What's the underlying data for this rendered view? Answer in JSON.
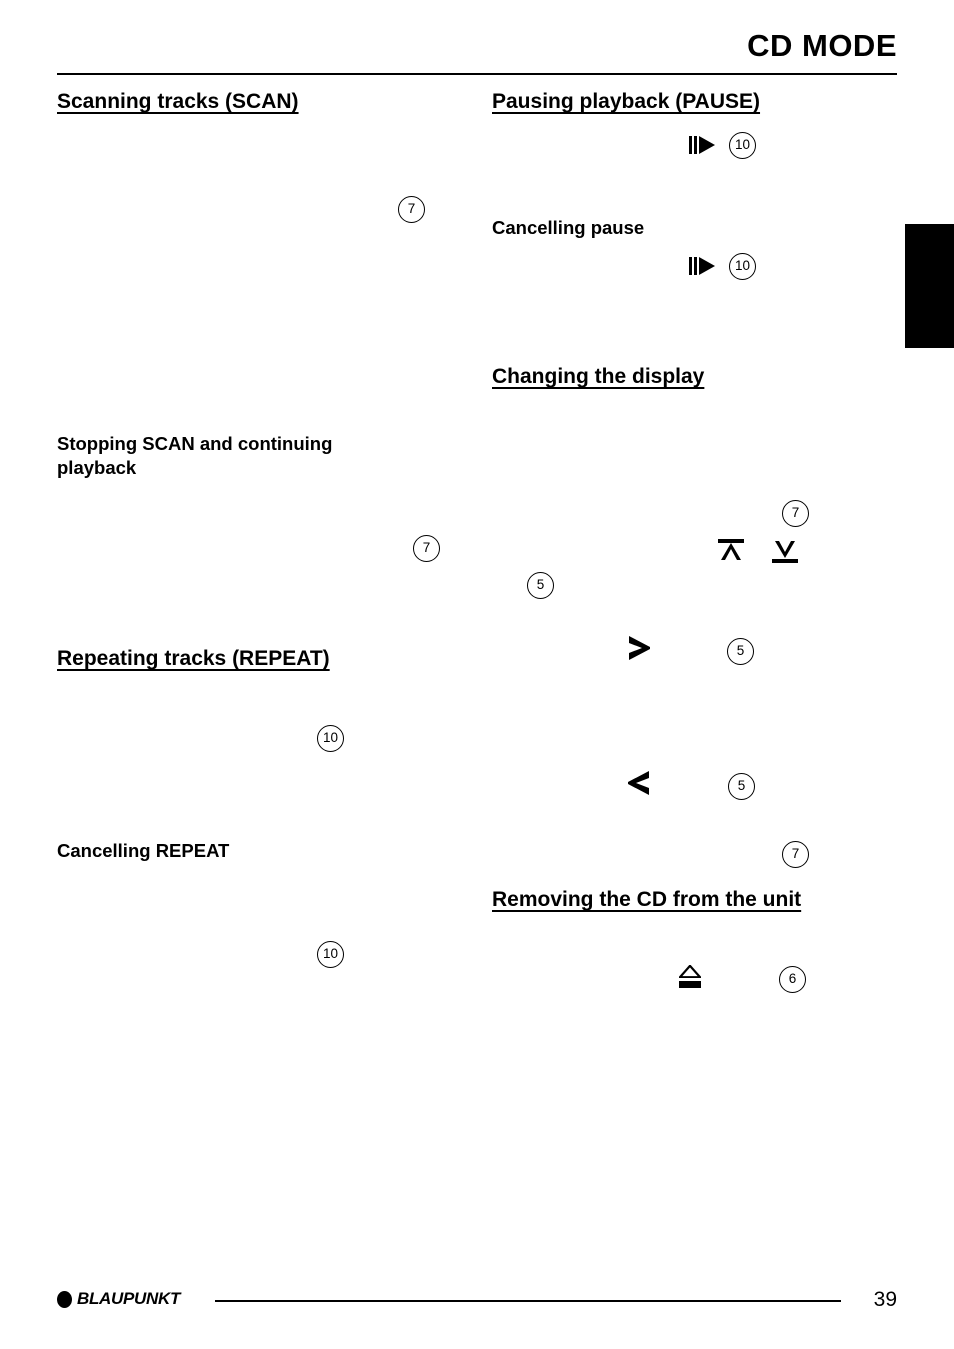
{
  "document": {
    "header_title": "CD MODE",
    "page_number": "39",
    "brand": "BLAUPUNKT"
  },
  "left_column": {
    "sections": [
      {
        "heading": "Scanning tracks (SCAN)",
        "refs": [
          {
            "label": "7"
          }
        ]
      },
      {
        "subheading_line1": "Stopping SCAN and continuing",
        "subheading_line2": "playback",
        "refs": [
          {
            "label": "7"
          }
        ]
      },
      {
        "heading": "Repeating tracks (REPEAT)",
        "refs": [
          {
            "label": "10"
          }
        ]
      },
      {
        "subheading": "Cancelling REPEAT",
        "refs": [
          {
            "label": "10"
          }
        ]
      }
    ]
  },
  "right_column": {
    "sections": [
      {
        "heading": "Pausing playback (PAUSE)",
        "icon": "pause-play-icon",
        "refs": [
          {
            "label": "10"
          }
        ]
      },
      {
        "subheading": "Cancelling pause",
        "icon": "pause-play-icon",
        "refs": [
          {
            "label": "10"
          }
        ]
      },
      {
        "heading": "Changing the display",
        "icons": [
          "arrow-up-bar-icon",
          "arrow-down-bar-icon",
          "chevron-right-icon",
          "chevron-left-icon"
        ],
        "refs": [
          {
            "label": "7"
          },
          {
            "label": "5"
          },
          {
            "label": "5"
          },
          {
            "label": "5"
          },
          {
            "label": "7"
          }
        ]
      },
      {
        "heading": "Removing the CD from the unit",
        "icon": "eject-icon",
        "refs": [
          {
            "label": "6"
          }
        ]
      }
    ]
  },
  "refs": {
    "r1": "7",
    "r2": "7",
    "r3": "10",
    "r4": "10",
    "r5": "10",
    "r6": "10",
    "r7": "7",
    "r8": "5",
    "r9": "5",
    "r10": "5",
    "r11": "7",
    "r12": "6"
  },
  "headings": {
    "scanning_tracks": "Scanning tracks (SCAN)",
    "stopping_scan_1": "Stopping SCAN and continuing",
    "stopping_scan_2": "playback",
    "repeating_tracks": "Repeating tracks (REPEAT)",
    "cancelling_repeat": "Cancelling REPEAT",
    "pausing_playback": "Pausing playback (PAUSE)",
    "cancelling_pause": "Cancelling pause",
    "changing_display": "Changing the display",
    "removing_cd": "Removing the CD from the unit"
  }
}
